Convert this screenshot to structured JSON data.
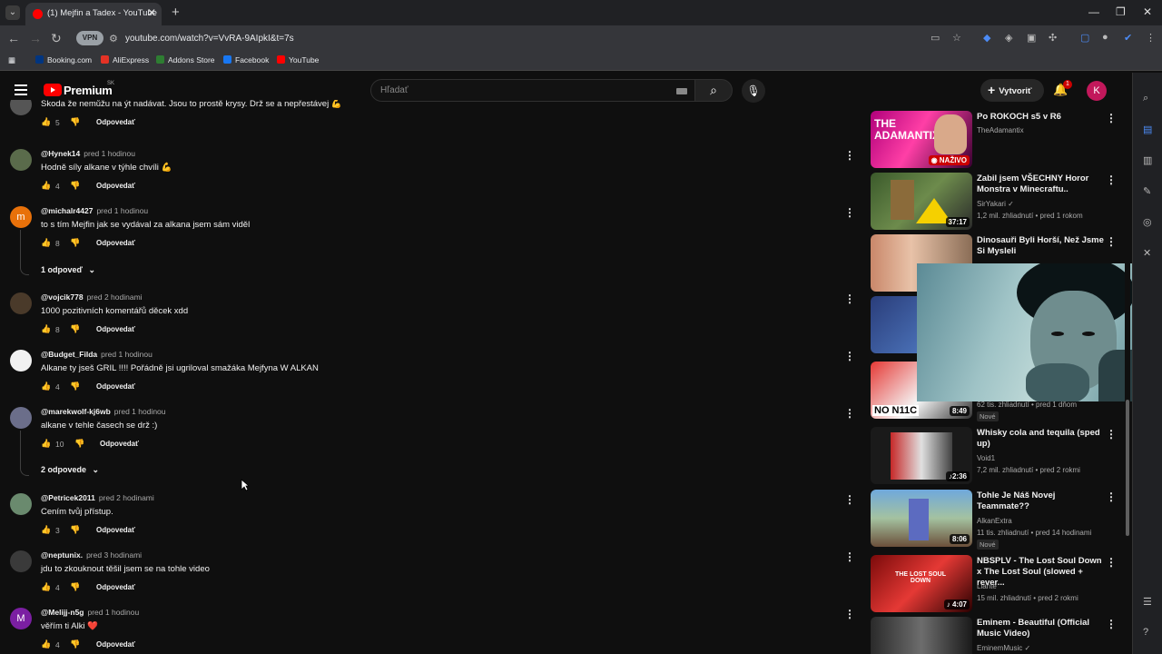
{
  "browser": {
    "tab_title": "(1) Mejfin a Tadex - YouTube",
    "tab_close": "✕",
    "new_tab": "+",
    "url": "youtube.com/watch?v=VvRA-9AIpkI&t=7s",
    "vpn_label": "VPN",
    "bookmarks": [
      "Booking.com",
      "AliExpress",
      "Addons Store",
      "Facebook",
      "YouTube"
    ]
  },
  "header": {
    "brand": "Premium",
    "brand_region": "SK",
    "search_placeholder": "Hľadať",
    "create_label": "Vytvoriť",
    "notification_count": "1",
    "account_initial": "K"
  },
  "comments": [
    {
      "author": "",
      "time": "",
      "text": "Škoda že nemůžu na ýt nadávat. Jsou to prostě krysy. Drž se a nepřestávej 💪",
      "likes": "5",
      "reply_label": "Odpovedať"
    },
    {
      "author": "@Hynek14",
      "time": "pred 1 hodinou",
      "text": "Hodně síly alkane v týhle chvíli 💪",
      "likes": "4",
      "reply_label": "Odpovedať"
    },
    {
      "author": "@michalr4427",
      "time": "pred 1 hodinou",
      "text": "to s tím Mejfin jak se vydával za alkana jsem sám viděl",
      "likes": "8",
      "reply_label": "Odpovedať",
      "avatar_letter": "m"
    },
    {
      "author": "@vojcik778",
      "time": "pred 2 hodinami",
      "text": "1000 pozitivních komentářů děcek xdd",
      "likes": "8",
      "reply_label": "Odpovedať"
    },
    {
      "author": "@Budget_Filda",
      "time": "pred 1 hodinou",
      "text": "Alkane ty jseš GRIL !!!! Pořádně jsi ugriloval smažáka Mejfyna W ALKAN",
      "likes": "4",
      "reply_label": "Odpovedať"
    },
    {
      "author": "@marekwolf-kj6wb",
      "time": "pred 1 hodinou",
      "text": "alkane v tehle časech se drž :)",
      "likes": "10",
      "reply_label": "Odpovedať"
    },
    {
      "author": "@Petricek2011",
      "time": "pred 2 hodinami",
      "text": "Cením tvůj přístup.",
      "likes": "3",
      "reply_label": "Odpovedať"
    },
    {
      "author": "@neptunix.",
      "time": "pred 3 hodinami",
      "text": "jdu to zkouknout těšil jsem se na tohle video",
      "likes": "4",
      "reply_label": "Odpovedať"
    },
    {
      "author": "@Melijj-n5g",
      "time": "pred 1 hodinou",
      "text": "věřím ti Alki ❤️",
      "likes": "4",
      "reply_label": "Odpovedať",
      "avatar_letter": "M"
    }
  ],
  "reply_toggles": [
    "1 odpoveď",
    "2 odpovede"
  ],
  "related": [
    {
      "title": "Po ROKOCH s5 v R6",
      "channel": "TheAdamantix",
      "meta": "",
      "badge": "NAŽIVO",
      "thumb_text": "THE ADAMANTIX"
    },
    {
      "title": "Zabil jsem VŠECHNY Horor Monstra v Minecraftu..",
      "channel": "SirYakari",
      "meta": "1,2 mil. zhliadnutí • pred 1 rokom",
      "duration": "37:17"
    },
    {
      "title": "Dinosauři Byli Horší, Než Jsme Si Mysleli",
      "channel": "",
      "meta": ""
    },
    {
      "title": "",
      "channel": "",
      "meta": ""
    },
    {
      "title": "",
      "channel": "",
      "meta": "62 tis. zhliadnutí • pred 1 dňom",
      "duration": "8:49",
      "new": "Nové",
      "thumb_text": "NO N11C"
    },
    {
      "title": "Whisky cola and tequila (sped up)",
      "channel": "Void1",
      "meta": "7,2 mil. zhliadnutí • pred 2 rokmi",
      "duration": "2:36"
    },
    {
      "title": "Tohle Je Náš Novej Teammate??",
      "channel": "AlkanExtra",
      "meta": "11 tis. zhliadnutí • pred 14 hodinami",
      "duration": "8:06",
      "new": "Nové"
    },
    {
      "title": "NBSPLV - The Lost Soul Down x The Lost Soul (slowed + rever...",
      "channel": "Liante",
      "meta": "15 mil. zhliadnutí • pred 2 rokmi",
      "duration": "4:07",
      "thumb_text": "THE LOST SOUL DOWN"
    },
    {
      "title": "Eminem - Beautiful (Official Music Video)",
      "channel": "EminemMusic",
      "meta": ""
    }
  ],
  "colors": {
    "background": "#0f0f0f",
    "accent_red": "#ff0000",
    "text_primary": "#f1f1f1",
    "text_secondary": "#aaaaaa"
  }
}
